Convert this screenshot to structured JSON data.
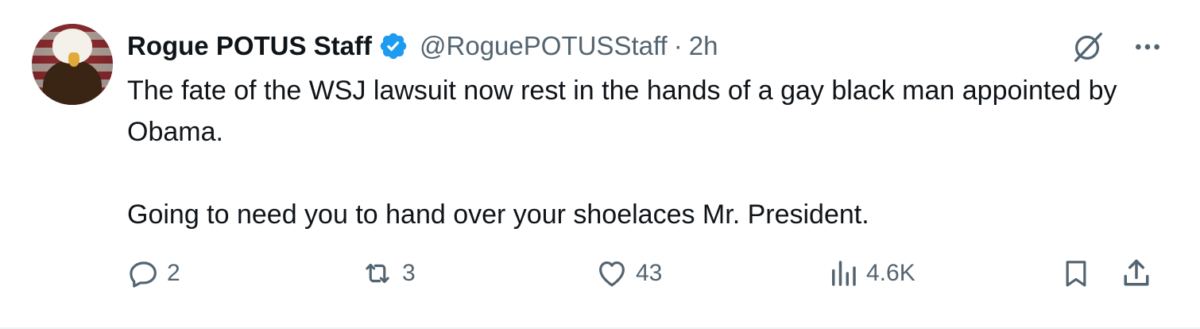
{
  "author": {
    "name": "Rogue POTUS Staff",
    "handle": "@RoguePOTUSStaff",
    "separator": "·",
    "time": "2h",
    "verified": true,
    "avatar_icon": "bald-eagle-avatar"
  },
  "tweet": {
    "paragraphs": [
      "The fate of the WSJ lawsuit now rest in the hands of a gay black man appointed by Obama.",
      "Going to need you to hand over your shoelaces Mr. President."
    ]
  },
  "stats": {
    "replies": "2",
    "reposts": "3",
    "likes": "43",
    "views": "4.6K"
  },
  "colors": {
    "text": "#0f1419",
    "muted": "#536471",
    "verified_blue": "#1d9bf0",
    "divider": "#eff3f4"
  },
  "icons": {
    "top": [
      "grok-icon",
      "more-icon"
    ],
    "actions": [
      "reply-icon",
      "repost-icon",
      "like-icon",
      "views-icon",
      "bookmark-icon",
      "share-icon"
    ]
  }
}
